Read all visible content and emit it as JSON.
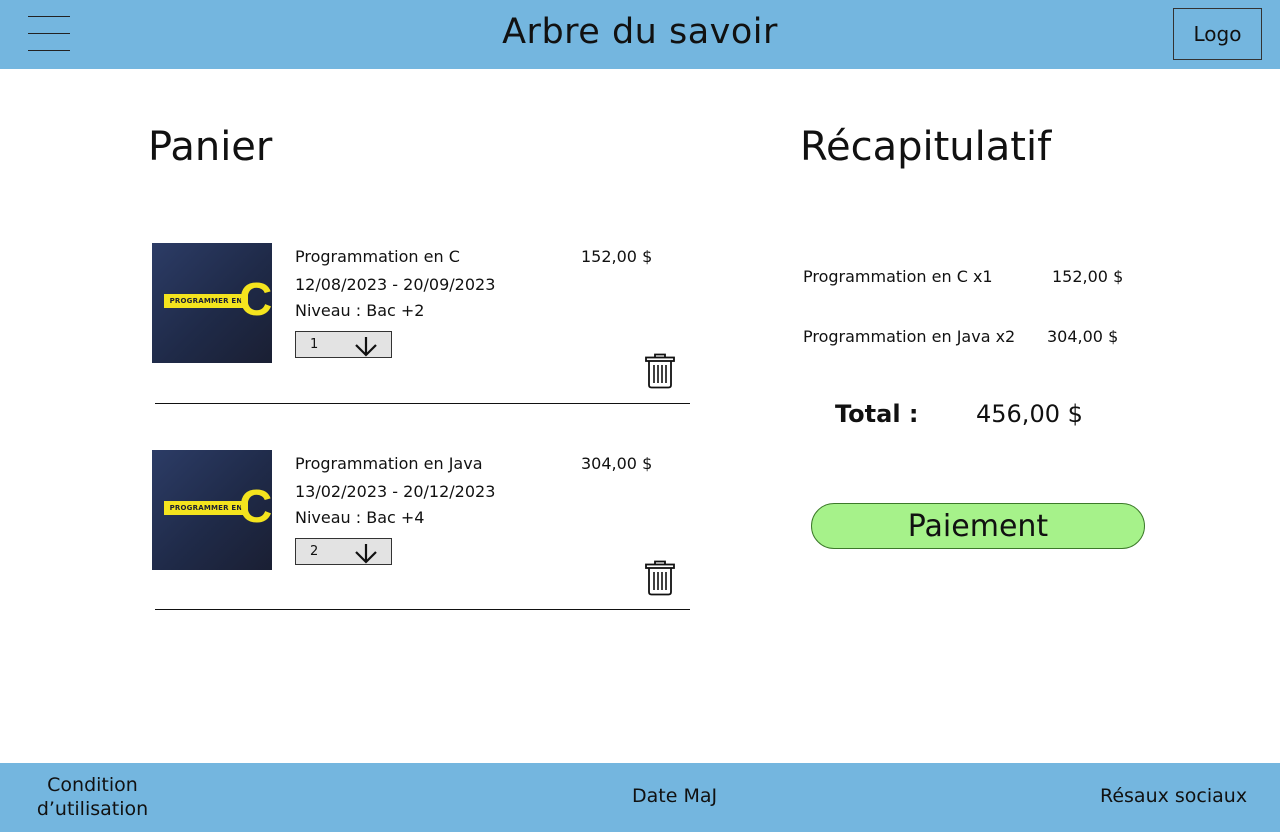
{
  "header": {
    "title": "Arbre du savoir",
    "logo": "Logo",
    "menu_icon": "hamburger-menu-icon"
  },
  "cart": {
    "title": "Panier",
    "items": [
      {
        "name": "Programmation en C",
        "dates": "12/08/2023 - 20/09/2023",
        "level": "Niveau : Bac +2",
        "price": "152,00 $",
        "quantity": "1",
        "thumb_text": "PROGRAMMER EN",
        "thumb_letter": "C"
      },
      {
        "name": "Programmation en Java",
        "dates": "13/02/2023 - 20/12/2023",
        "level": "Niveau : Bac +4",
        "price": "304,00 $",
        "quantity": "2",
        "thumb_text": "PROGRAMMER EN",
        "thumb_letter": "C"
      }
    ]
  },
  "summary": {
    "title": "Récapitulatif",
    "lines": [
      {
        "label": "Programmation en C x1",
        "amount": "152,00 $"
      },
      {
        "label": "Programmation en Java x2",
        "amount": "304,00 $"
      }
    ],
    "total_label": "Total :",
    "total_amount": "456,00 $",
    "pay_button": "Paiement"
  },
  "footer": {
    "terms_line1": "Condition",
    "terms_line2": "d’utilisation",
    "update_date": "Date MaJ",
    "social": "Résaux sociaux"
  },
  "colors": {
    "header_bg": "#74b6df",
    "pay_button_bg": "#a6f28a",
    "thumb_accent": "#f4e41e"
  }
}
